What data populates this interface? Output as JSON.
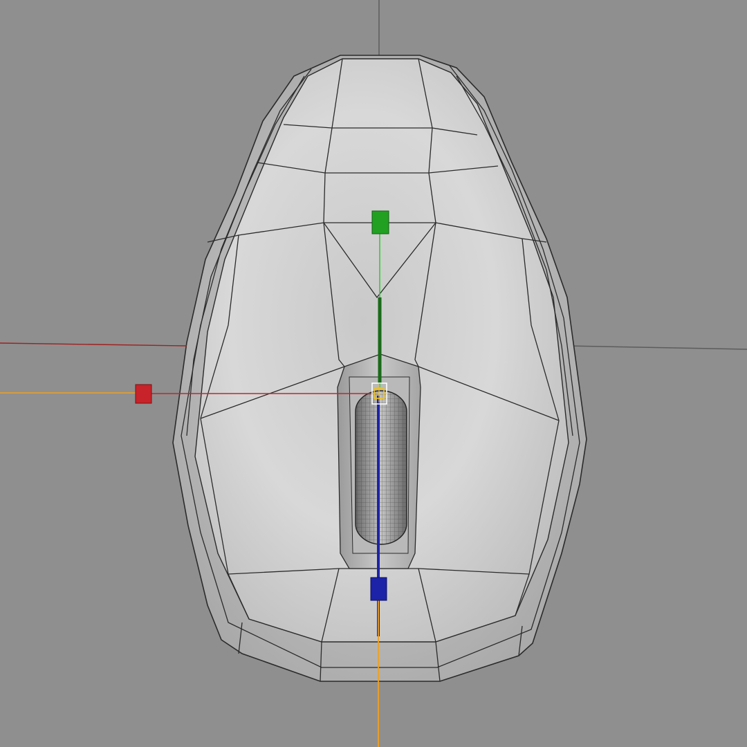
{
  "viewport": {
    "background_color": "#8f8f8f",
    "view": "top",
    "object": "computer-mouse",
    "shading": "smooth-shaded-with-wireframe"
  },
  "gizmo": {
    "type": "move",
    "x_axis_color": "#c8232a",
    "y_axis_color": "#22a022",
    "z_axis_color": "#1c23a8",
    "pivot_color": "#f0c21b",
    "handle_icon": "square-handle-icon"
  },
  "colors": {
    "wire": "#2a2a2a",
    "scene_grid": "#5c5c5c",
    "timeline_orange": "#f0a020"
  }
}
